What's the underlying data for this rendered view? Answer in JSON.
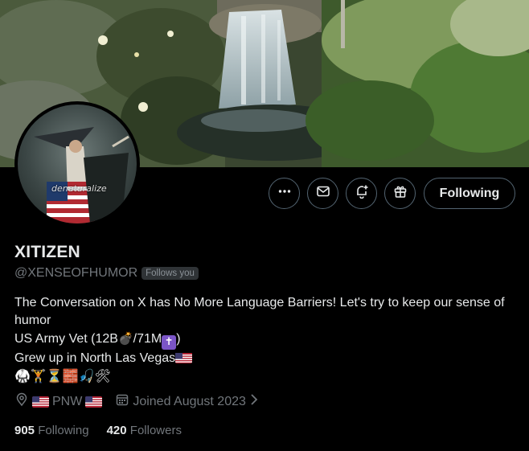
{
  "profile": {
    "name": "XITIZEN",
    "handle": "@XENSEOFHUMOR",
    "follows_you_badge": "Follows you",
    "avatar_watermark": "denaturalize",
    "bio": {
      "line1": "The Conversation on X has No More Language Barriers! Let's try to keep our sense of humor",
      "line2_prefix": "US Army Vet (12B",
      "line2_mid": "/71M",
      "line2_suffix": ")",
      "line3": "Grew up in North Las Vegas",
      "line4_emojis": "🥋🏋⏳🧱🎣🛠"
    },
    "location": "PNW",
    "joined": "Joined August 2023",
    "following_count": "905",
    "following_label": "Following",
    "followers_count": "420",
    "followers_label": "Followers"
  },
  "actions": {
    "more_icon": "more-icon",
    "message_icon": "mail-icon",
    "notify_icon": "bell-plus-icon",
    "subscribe_icon": "gift-icon",
    "follow_label": "Following"
  },
  "colors": {
    "background": "#000000",
    "primary_text": "#e7e9ea",
    "secondary_text": "#71767b",
    "border": "#536471",
    "badge_bg": "#2f3336"
  }
}
